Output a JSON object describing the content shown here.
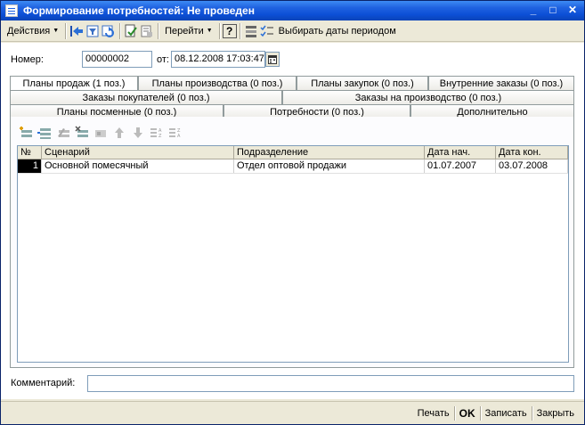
{
  "window": {
    "title": "Формирование потребностей: Не проведен",
    "buttons": [
      "_",
      "□",
      "✕"
    ]
  },
  "toolbar": {
    "actions_label": "Действия",
    "goto_label": "Перейти",
    "help_label": "?",
    "select_dates_label": "Выбирать даты периодом"
  },
  "header": {
    "number_label": "Номер:",
    "number_value": "00000002",
    "from_label": "от:",
    "date_value": "08.12.2008 17:03:47"
  },
  "tabs": {
    "row1": [
      "Планы продаж (1 поз.)",
      "Планы производства (0 поз.)",
      "Планы закупок (0 поз.)",
      "Внутренние заказы (0 поз.)"
    ],
    "row2": [
      "Заказы покупателей (0 поз.)",
      "Заказы на производство (0 поз.)"
    ],
    "row3": [
      "Планы посменные (0 поз.)",
      "Потребности (0 поз.)",
      "Дополнительно"
    ]
  },
  "grid": {
    "columns": [
      "№",
      "Сценарий",
      "Подразделение",
      "Дата нач.",
      "Дата кон."
    ],
    "rows": [
      [
        "1",
        "Основной помесячный",
        "Отдел оптовой продажи",
        "01.07.2007",
        "03.07.2008"
      ]
    ]
  },
  "comment": {
    "label": "Комментарий:",
    "value": ""
  },
  "bottom": {
    "print_label": "Печать",
    "ok_label": "OK",
    "save_label": "Записать",
    "close_label": "Закрыть"
  },
  "colors": {
    "titlebar": "#0c4fd6",
    "window_bg": "#ECE9D8",
    "field_border": "#7f9db9"
  }
}
